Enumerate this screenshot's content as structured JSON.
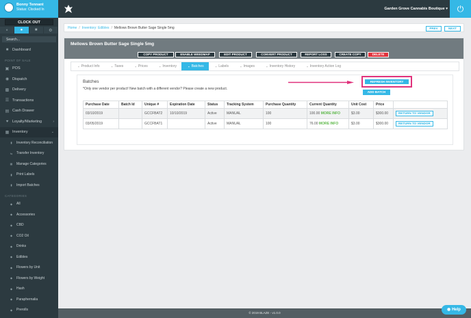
{
  "sidebar": {
    "user_name": "Bonny Tennant",
    "user_status": "Status: Clocked In",
    "clock_out": "CLOCK OUT",
    "search_placeholder": "Search...",
    "dashboard": "Dashboard",
    "pos_header": "POINT OF SALE",
    "pos_items": [
      "POS",
      "Dispatch",
      "Delivery",
      "Transactions",
      "Cash Drawer",
      "Loyalty/Marketing",
      "Inventory"
    ],
    "inventory_items": [
      "Inventory Reconciliation",
      "Transfer Inventory",
      "Manage Categories",
      "Print Labels",
      "Import Batches"
    ],
    "categories_header": "CATEGORIES",
    "categories": [
      "All",
      "Accessories",
      "CBD",
      "CO2 Oil",
      "Drinks",
      "Edibles",
      "Flowers by Unit",
      "Flowers by Weight",
      "Hash",
      "Paraphernalia",
      "Prerolls"
    ]
  },
  "topbar": {
    "store": "Garden Grove Cannabis Boutique"
  },
  "breadcrumb": {
    "home": "Home",
    "inventory": "Inventory: Edibles",
    "current": "Mellows Brown Butter Sage Single 5mg",
    "prev": "PREV",
    "next": "NEXT"
  },
  "product": {
    "title": "Mellows Brown Butter Sage Single 5mg",
    "actions": [
      "COPY PRODUCT",
      "ENABLE WEEDMAP",
      "EDIT PRODUCT",
      "CONVERT PRODUCT",
      "REPORT LOSS",
      "CREATE COPY",
      "DELETE"
    ]
  },
  "tabs": [
    "Product Info",
    "Taxes",
    "Prices",
    "Inventory",
    "Batches",
    "Labels",
    "Images",
    "Inventory History",
    "Inventory Action Log"
  ],
  "batches": {
    "title": "Batches",
    "note": "*Only one vendor per product! New batch with a different vendor? Please create a new product.",
    "refresh": "REFRESH INVENTORY",
    "add": "ADD BATCH",
    "headers": [
      "Purchase Date",
      "Batch Id",
      "Unique #",
      "Expiration Date",
      "Status",
      "Tracking System",
      "Purchase Quantity",
      "Current Quantity",
      "Unit Cost",
      "Price",
      ""
    ],
    "more_info": "MORE INFO",
    "return_label": "RETURN TO VENDOR",
    "rows": [
      {
        "purchase_date": "03/10/2019",
        "batch_id": "",
        "unique": "GCCFBAT2",
        "expiration": "10/10/2019",
        "status": "Active",
        "tracking": "MANUAL",
        "purchase_qty": "100",
        "current_qty": "100.00",
        "unit_cost": "$3.00",
        "price": "$300.00"
      },
      {
        "purchase_date": "03/05/2019",
        "batch_id": "",
        "unique": "GCCFBAT1",
        "expiration": "",
        "status": "Active",
        "tracking": "MANUAL",
        "purchase_qty": "100",
        "current_qty": "76.00",
        "unit_cost": "$3.00",
        "price": "$300.00"
      }
    ]
  },
  "footer": "© 2019 BLAZE - v1.0.0",
  "help": "Help"
}
